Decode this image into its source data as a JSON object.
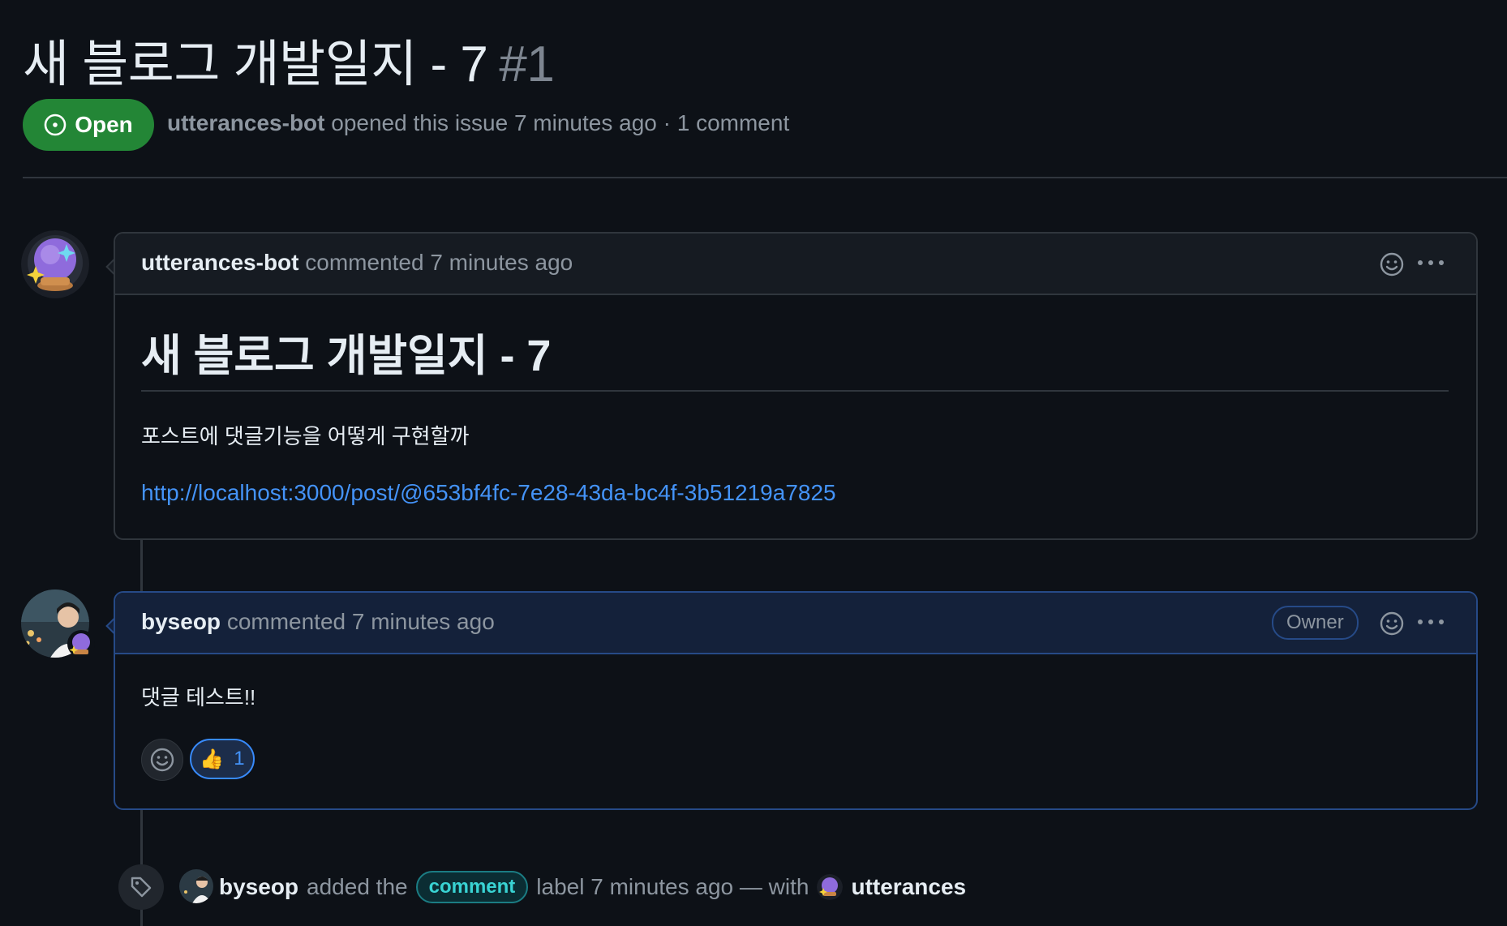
{
  "issue": {
    "title": "새 블로그 개발일지 - 7",
    "number": "#1",
    "state": "Open",
    "author": "utterances-bot",
    "meta_opened": "opened this issue 7 minutes ago · 1 comment"
  },
  "comments": [
    {
      "author": "utterances-bot",
      "meta": "commented 7 minutes ago",
      "avatar_icon": "crystal-ball-icon",
      "body": {
        "heading": "새 블로그 개발일지 - 7",
        "paragraph": "포스트에 댓글기능을 어떻게 구현할까",
        "link": "http://localhost:3000/post/@653bf4fc-7e28-43da-bc4f-3b51219a7825"
      }
    },
    {
      "author": "byseop",
      "meta": "commented 7 minutes ago",
      "badge": "Owner",
      "body": {
        "text": "댓글 테스트!!"
      },
      "reactions": [
        {
          "emoji": "👍",
          "count": "1"
        }
      ]
    }
  ],
  "event": {
    "actor": "byseop",
    "text_before": "added the",
    "label": "comment",
    "text_after": "label 7 minutes ago — with",
    "app": "utterances"
  },
  "colors": {
    "background": "#0d1117",
    "open_green": "#238636",
    "link_blue": "#4493f8",
    "owner_border": "#264a87",
    "label_teal": "#39d3d3"
  }
}
